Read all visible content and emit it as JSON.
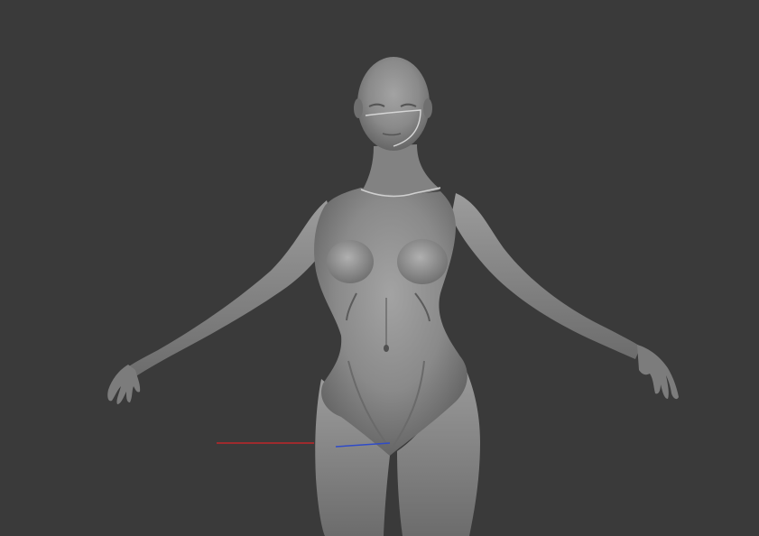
{
  "viewport": {
    "background": "#3a3a3a",
    "model": {
      "kind": "sculpt-mesh",
      "material_color": "#8a8a8a",
      "shadow_color": "#4e4e4e",
      "highlight_color": "#b5b5b5"
    },
    "axes": {
      "x_axis_color": "#c0262b",
      "z_axis_color": "#2f4bc8"
    }
  }
}
